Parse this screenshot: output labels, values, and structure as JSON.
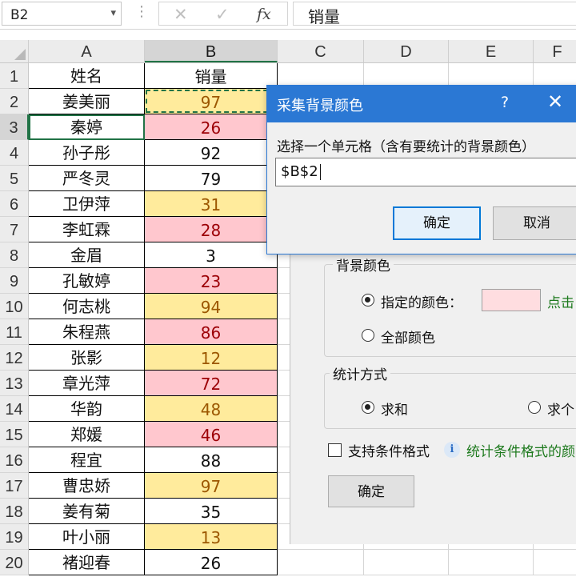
{
  "formula_bar": {
    "name_box": "B2",
    "name_box_arrow": "▾",
    "dots": "⋮",
    "cancel_glyph": "✕",
    "enter_glyph": "✓",
    "fx_glyph": "fx",
    "formula_value": "销量"
  },
  "columns": [
    "A",
    "B",
    "C",
    "D",
    "E",
    "F"
  ],
  "selected_column": "B",
  "rows": [
    {
      "num": "1",
      "name": "姓名",
      "sales": "销量",
      "fill": "plain"
    },
    {
      "num": "2",
      "name": "姜美丽",
      "sales": "97",
      "fill": "yellow"
    },
    {
      "num": "3",
      "name": "秦婷",
      "sales": "26",
      "fill": "pink"
    },
    {
      "num": "4",
      "name": "孙子彤",
      "sales": "92",
      "fill": "plain"
    },
    {
      "num": "5",
      "name": "严冬灵",
      "sales": "79",
      "fill": "plain"
    },
    {
      "num": "6",
      "name": "卫伊萍",
      "sales": "31",
      "fill": "yellow"
    },
    {
      "num": "7",
      "name": "李虹霖",
      "sales": "28",
      "fill": "pink"
    },
    {
      "num": "8",
      "name": "金眉",
      "sales": "3",
      "fill": "plain"
    },
    {
      "num": "9",
      "name": "孔敏婷",
      "sales": "23",
      "fill": "pink"
    },
    {
      "num": "10",
      "name": "何志桃",
      "sales": "94",
      "fill": "yellow"
    },
    {
      "num": "11",
      "name": "朱程燕",
      "sales": "86",
      "fill": "pink"
    },
    {
      "num": "12",
      "name": "张影",
      "sales": "12",
      "fill": "yellow"
    },
    {
      "num": "13",
      "name": "章光萍",
      "sales": "72",
      "fill": "pink"
    },
    {
      "num": "14",
      "name": "华韵",
      "sales": "48",
      "fill": "yellow"
    },
    {
      "num": "15",
      "name": "郑媛",
      "sales": "46",
      "fill": "pink"
    },
    {
      "num": "16",
      "name": "程宜",
      "sales": "88",
      "fill": "plain"
    },
    {
      "num": "17",
      "name": "曹忠娇",
      "sales": "97",
      "fill": "yellow"
    },
    {
      "num": "18",
      "name": "姜有菊",
      "sales": "35",
      "fill": "plain"
    },
    {
      "num": "19",
      "name": "叶小丽",
      "sales": "13",
      "fill": "yellow"
    },
    {
      "num": "20",
      "name": "褚迎春",
      "sales": "26",
      "fill": "plain"
    }
  ],
  "fill_colors": {
    "yellow": "#ffeb9c",
    "pink": "#ffc7ce",
    "plain": "#ffffff"
  },
  "dialog_front": {
    "title": "采集背景颜色",
    "help": "?",
    "close": "✕",
    "prompt": "选择一个单元格（含有要统计的背景颜色）",
    "input_value": "$B$2",
    "ok_label": "确定",
    "cancel_label": "取消"
  },
  "dialog_back": {
    "bg_group_title": "背景颜色",
    "specified_color_label": "指定的颜色：",
    "swatch_color": "#ffdde0",
    "pick_link": "点击",
    "all_colors_label": "全部颜色",
    "stat_group_title": "统计方式",
    "sum_label": "求和",
    "count_label": "求个",
    "support_cf_label": "支持条件格式",
    "info_icon": "i",
    "info_text": "统计条件格式的颜",
    "ok_label": "确定"
  }
}
